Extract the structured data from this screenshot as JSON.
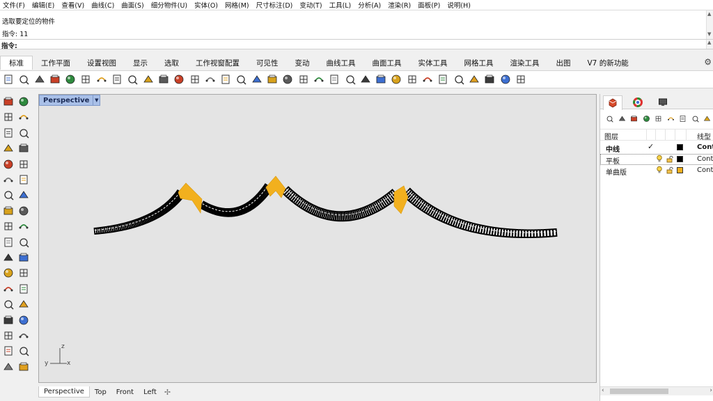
{
  "menu": [
    "文件(F)",
    "编辑(E)",
    "查看(V)",
    "曲线(C)",
    "曲面(S)",
    "细分物件(U)",
    "实体(O)",
    "网格(M)",
    "尺寸标注(D)",
    "变动(T)",
    "工具(L)",
    "分析(A)",
    "渲染(R)",
    "面板(P)",
    "说明(H)"
  ],
  "command": {
    "history": [
      "选取要定位的物件",
      "指令: 11"
    ],
    "prompt": "指令:"
  },
  "tabs": [
    "标准",
    "工作平面",
    "设置视图",
    "显示",
    "选取",
    "工作视窗配置",
    "可见性",
    "变动",
    "曲线工具",
    "曲面工具",
    "实体工具",
    "网格工具",
    "渲染工具",
    "出图",
    "V7 的新功能"
  ],
  "active_tab": "标准",
  "toolbar_icons": [
    "new-icon",
    "open-icon",
    "save-icon",
    "print-icon",
    "import-icon",
    "cut-icon",
    "copy-icon",
    "paste-icon",
    "undo-icon",
    "pan-icon",
    "move-view-icon",
    "zoom-icon",
    "zoom-window-icon",
    "zoom-extents-icon",
    "zoom-selected-icon",
    "rotate-view-icon",
    "four-view-icon",
    "car-icon",
    "camera-icon",
    "circle-view-icon",
    "grid-snap-icon",
    "bulb-icon",
    "lock-icon",
    "layer-icon",
    "color-wheel-icon",
    "sphere-icon",
    "shaded-sphere-icon",
    "render-sphere-icon",
    "pencil-icon",
    "gears-icon",
    "dimension-icon",
    "globe-icon",
    "help-icon",
    "options-icon"
  ],
  "left_icons": [
    "select-icon",
    "point-icon",
    "polyline-icon",
    "control-point-curve-icon",
    "circle-icon",
    "ellipse-icon",
    "polygon-icon",
    "rectangle-icon",
    "circle-tan-icon",
    "fillet-curve-icon",
    "surface-edge-icon",
    "revolve-icon",
    "box-icon",
    "sphere-solid-icon",
    "cylinder-icon",
    "mesh-icon",
    "boolean-icon",
    "explode-icon",
    "trim-icon",
    "split-icon",
    "blend-icon",
    "extend-icon",
    "curve-from-object-icon",
    "rebuild-icon",
    "text-icon",
    "scale-icon",
    "array-icon",
    "mirror-icon",
    "block-icon",
    "dot-icon",
    "grid-array-icon",
    "drafting-icon",
    "cube-analyze-icon",
    "check-icon",
    "render-icon",
    "paint-icon"
  ],
  "viewport": {
    "title": "Perspective",
    "axis_z": "z",
    "axis_y": "y",
    "axis_x": "x"
  },
  "viewport_tabs": [
    "Perspective",
    "Top",
    "Front",
    "Left"
  ],
  "active_viewport_tab": "Perspective",
  "layers": {
    "header_name": "图层",
    "header_linetype": "线型",
    "rows": [
      {
        "name": "中线",
        "check": "✓",
        "linetype": "Cont",
        "color": "#000000",
        "bold": true
      },
      {
        "name": "平板",
        "check": "",
        "linetype": "Cont",
        "color": "#000000",
        "bold": false
      },
      {
        "name": "单曲版",
        "check": "",
        "linetype": "Cont",
        "color": "#f2b01e",
        "bold": false
      }
    ]
  },
  "colors": {
    "accent_yellow": "#f2b01e",
    "viewport_bg": "#e4e4e4",
    "viewport_title_bg": "#a9c0e8"
  }
}
